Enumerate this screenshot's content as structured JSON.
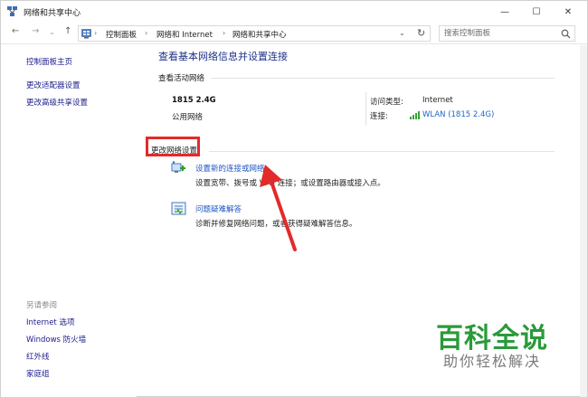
{
  "window": {
    "title": "网络和共享中心",
    "title_icon": "network-center-icon",
    "controls": {
      "minimize": "—",
      "maximize": "☐",
      "close": "✕"
    }
  },
  "addressbar": {
    "back": "←",
    "forward": "→",
    "recent": "⌄",
    "up": "↑",
    "breadcrumbs": [
      "控制面板",
      "网络和 Internet",
      "网络和共享中心"
    ],
    "separator": "›",
    "dropdown": "⌄",
    "refresh": "↻"
  },
  "search": {
    "placeholder": "搜索控制面板",
    "value": ""
  },
  "sidebar": {
    "links": [
      "控制面板主页",
      "更改适配器设置",
      "更改高级共享设置"
    ],
    "see_also": {
      "heading": "另请参阅",
      "items": [
        "Internet 选项",
        "Windows 防火墙",
        "红外线",
        "家庭组"
      ]
    }
  },
  "main": {
    "page_title": "查看基本网络信息并设置连接",
    "active_networks": {
      "label": "查看活动网络",
      "network_name": "1815 2.4G",
      "network_type": "公用网络",
      "access_type_label": "访问类型:",
      "access_type_value": "Internet",
      "connection_label": "连接:",
      "connection_value": "WLAN (1815 2.4G)"
    },
    "change_settings": {
      "label": "更改网络设置",
      "tasks": [
        {
          "icon": "new-connection-icon",
          "link": "设置新的连接或网络",
          "description": "设置宽带、拨号或 VPN 连接；或设置路由器或接入点。"
        },
        {
          "icon": "troubleshoot-icon",
          "link": "问题疑难解答",
          "description": "诊断并修复网络问题，或者获得疑难解答信息。"
        }
      ]
    }
  },
  "watermark": {
    "main": "百科全说",
    "sub": "助你轻松解决"
  },
  "colors": {
    "link": "#1f55c6",
    "title": "#1e3287",
    "annotation": "#e32a2a",
    "watermark": "#2a9a3a"
  }
}
